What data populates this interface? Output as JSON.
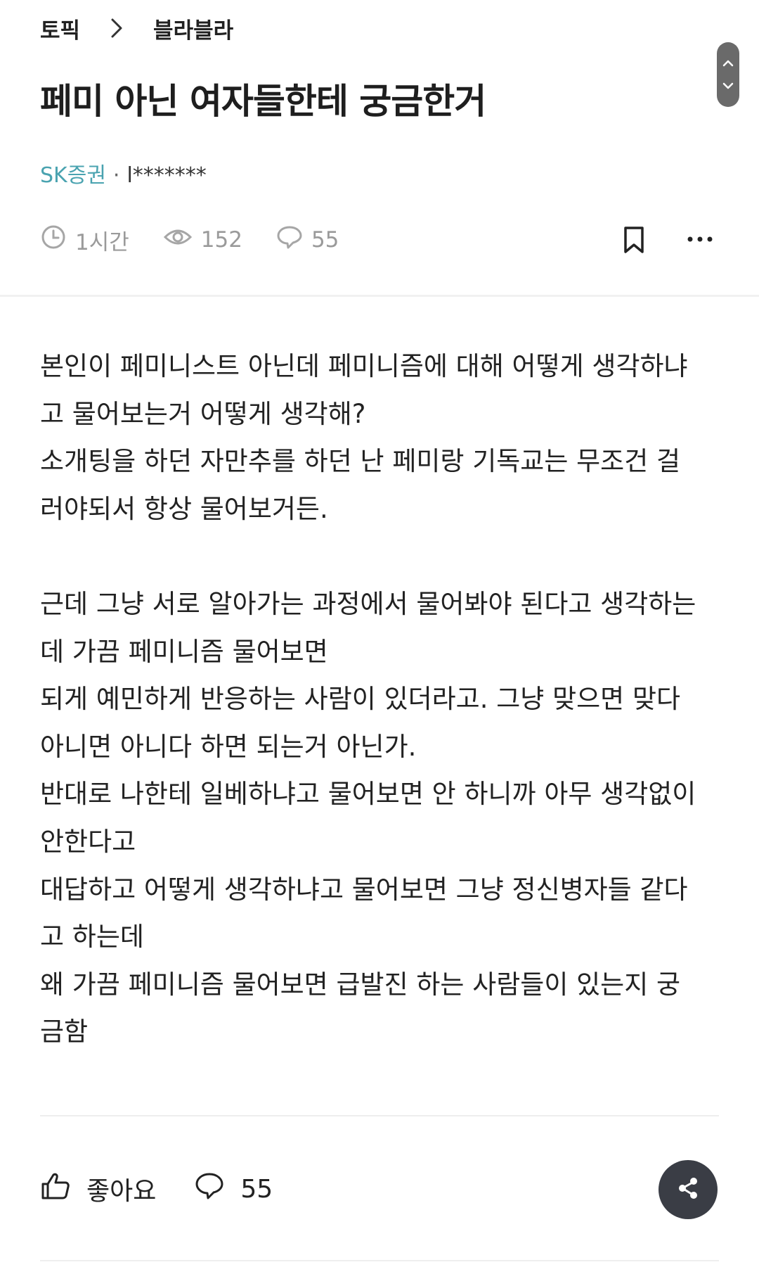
{
  "breadcrumb": {
    "topic": "토픽",
    "board": "블라블라"
  },
  "post": {
    "title": "페미 아닌 여자들한테 궁금한거",
    "company": "SK증권",
    "separator": "·",
    "nickname": "l*******",
    "time": "1시간",
    "views": "152",
    "comments": "55",
    "body_lines": [
      "본인이 페미니스트 아닌데 페미니즘에 대해 어떻게 생각하냐",
      "고 물어보는거 어떻게 생각해?",
      "소개팅을 하던 자만추를 하던 난 페미랑 기독교는 무조건 걸",
      "러야되서 항상 물어보거든.",
      "",
      "근데 그냥 서로 알아가는 과정에서 물어봐야 된다고 생각하는",
      "데 가끔 페미니즘 물어보면",
      "되게 예민하게 반응하는 사람이 있더라고. 그냥 맞으면 맞다",
      "아니면 아니다 하면 되는거 아닌가.",
      "반대로 나한테 일베하냐고 물어보면 안 하니까 아무 생각없이",
      "안한다고",
      "대답하고 어떻게 생각하냐고 물어보면 그냥 정신병자들 같다",
      "고 하는데",
      "왜 가끔 페미니즘 물어보면 급발진 하는 사람들이 있는지 궁",
      "금함"
    ]
  },
  "actions": {
    "like_label": "좋아요",
    "comment_count": "55"
  },
  "icons": {
    "chevron": "chevron-right-icon",
    "clock": "clock-icon",
    "eye": "eye-icon",
    "comment": "comment-icon",
    "bookmark": "bookmark-icon",
    "more": "more-icon",
    "like": "thumbs-up-icon",
    "share": "share-icon"
  },
  "colors": {
    "company": "#4aa3b0",
    "meta": "#9a9a9a",
    "share_bg": "#3a3d45"
  }
}
